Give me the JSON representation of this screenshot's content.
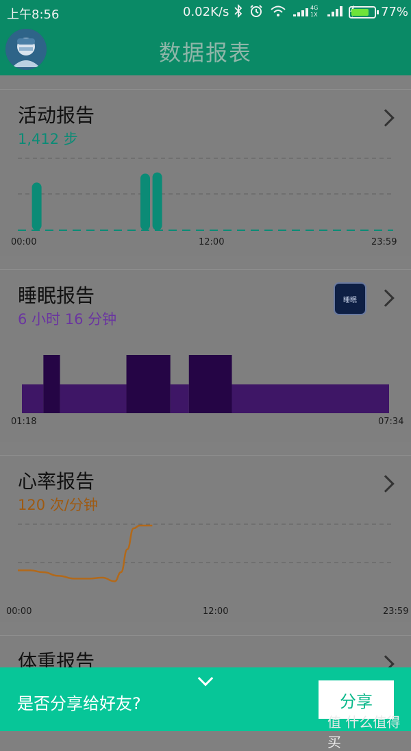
{
  "status": {
    "time": "上午8:56",
    "net_speed": "0.02K/s",
    "sim_label_top": "4G",
    "sim_label_bottom": "1X",
    "battery_pct": "77%",
    "battery_level": 0.77,
    "icons": [
      "bluetooth-icon",
      "alarm-icon",
      "wifi-icon",
      "signal-icon",
      "charging-icon"
    ]
  },
  "appbar": {
    "title": "数据报表"
  },
  "activity": {
    "title": "活动报告",
    "value": "1,412 步",
    "color": "#0b8b76",
    "x_labels": [
      "00:00",
      "12:00",
      "23:59"
    ]
  },
  "sleep": {
    "title": "睡眠报告",
    "value": "6 小时 16 分钟",
    "color": "#6a35a0",
    "app_label": "睡眠",
    "x_labels": [
      "01:18",
      "07:34"
    ]
  },
  "heart": {
    "title": "心率报告",
    "value": "120 次/分钟",
    "color": "#9e5a12",
    "x_labels": [
      "00:00",
      "12:00",
      "23:59"
    ]
  },
  "weight": {
    "title": "体重报告"
  },
  "share": {
    "prompt": "是否分享给好友?",
    "button": "分享"
  },
  "watermark": "值 什么值得买",
  "chart_data": [
    {
      "type": "bar",
      "title": "活动报告",
      "x_range": [
        "00:00",
        "23:59"
      ],
      "x": [
        0.8,
        8.0,
        8.8
      ],
      "values": [
        0.8,
        0.95,
        0.97
      ],
      "baseline_dashed": true,
      "grid": true
    },
    {
      "type": "bar",
      "title": "睡眠报告",
      "x_range": [
        "01:18",
        "07:34"
      ],
      "segments": [
        {
          "start": "01:18",
          "end": "01:40",
          "stage": "light"
        },
        {
          "start": "01:40",
          "end": "01:57",
          "stage": "deep"
        },
        {
          "start": "01:57",
          "end": "03:05",
          "stage": "light"
        },
        {
          "start": "03:05",
          "end": "03:50",
          "stage": "deep"
        },
        {
          "start": "03:50",
          "end": "04:09",
          "stage": "light"
        },
        {
          "start": "04:09",
          "end": "04:53",
          "stage": "deep"
        },
        {
          "start": "04:53",
          "end": "07:34",
          "stage": "light"
        }
      ],
      "stage_colors": {
        "light": "#3e1666",
        "deep": "#250545"
      }
    },
    {
      "type": "line",
      "title": "心率报告",
      "x_range": [
        "00:00",
        "23:59"
      ],
      "x": [
        0.0,
        0.8,
        1.6,
        2.6,
        3.6,
        4.6,
        5.4,
        6.2,
        6.6,
        7.0,
        7.4,
        7.8,
        8.2,
        8.6
      ],
      "values": [
        72,
        72,
        70,
        66,
        63,
        63,
        64,
        60,
        70,
        95,
        118,
        121,
        121,
        121
      ]
    }
  ]
}
